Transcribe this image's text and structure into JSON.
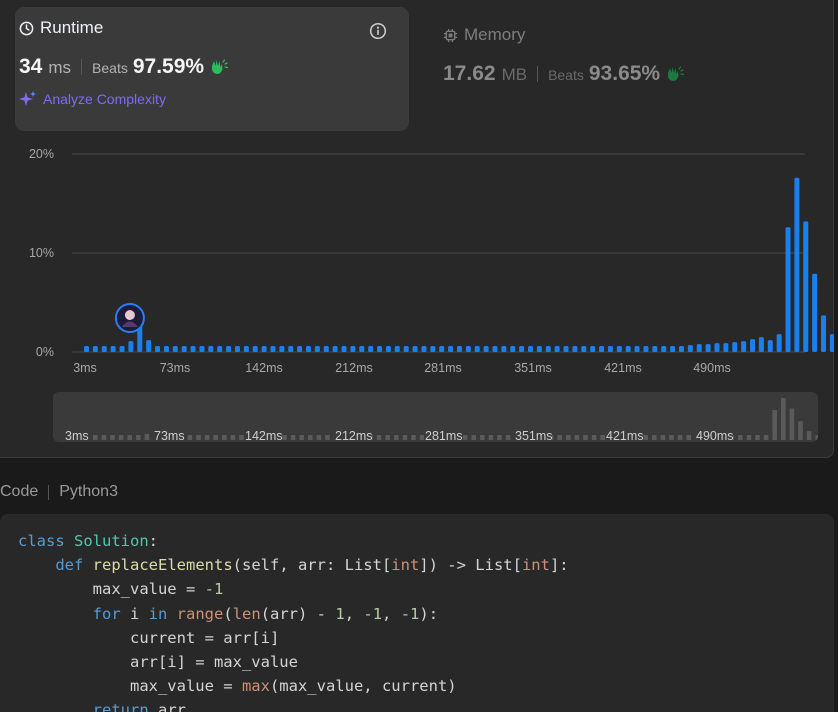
{
  "runtime": {
    "title": "Runtime",
    "value": "34",
    "unit": "ms",
    "beats_label": "Beats",
    "beats_pct": "97.59%",
    "icon": "clock-icon"
  },
  "memory": {
    "title": "Memory",
    "value": "17.62",
    "unit": "MB",
    "beats_label": "Beats",
    "beats_pct": "93.65%",
    "icon": "chip-icon"
  },
  "analyze_label": "Analyze Complexity",
  "colors": {
    "accent_bar": "#1a80f0",
    "analyze": "#7c6cf2",
    "beats_hand": "#2cbb5d"
  },
  "chart_data": {
    "type": "bar",
    "y_ticks": [
      "20%",
      "10%",
      "0%"
    ],
    "ylim": [
      0,
      20
    ],
    "x_tick_labels": [
      "3ms",
      "73ms",
      "142ms",
      "212ms",
      "281ms",
      "351ms",
      "421ms",
      "490ms"
    ],
    "values": [
      0.6,
      0.6,
      0.6,
      0.6,
      0.6,
      1.1,
      2.6,
      1.2,
      0.6,
      0.6,
      0.6,
      0.6,
      0.6,
      0.6,
      0.6,
      0.6,
      0.6,
      0.6,
      0.6,
      0.6,
      0.6,
      0.6,
      0.6,
      0.6,
      0.6,
      0.6,
      0.6,
      0.6,
      0.6,
      0.6,
      0.6,
      0.6,
      0.6,
      0.6,
      0.6,
      0.6,
      0.6,
      0.6,
      0.6,
      0.6,
      0.6,
      0.6,
      0.6,
      0.6,
      0.6,
      0.6,
      0.6,
      0.6,
      0.6,
      0.6,
      0.6,
      0.6,
      0.6,
      0.6,
      0.6,
      0.6,
      0.6,
      0.6,
      0.6,
      0.6,
      0.6,
      0.6,
      0.6,
      0.6,
      0.6,
      0.6,
      0.6,
      0.6,
      0.7,
      0.8,
      0.8,
      0.9,
      0.9,
      1.0,
      1.1,
      1.3,
      1.5,
      1.2,
      1.8,
      12.6,
      17.6,
      13.2,
      7.9,
      3.7,
      1.8,
      0.6
    ],
    "highlight_index": 5,
    "grid": true
  },
  "code": {
    "header_label": "Code",
    "language": "Python3"
  }
}
